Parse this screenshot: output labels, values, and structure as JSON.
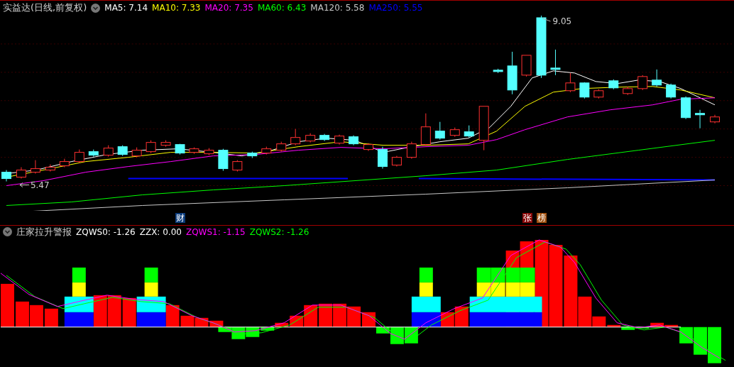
{
  "main_chart": {
    "title": "实益达(日线,前复权)",
    "indicators": [
      {
        "label": "MA5: 7.14",
        "color": "#ffffff"
      },
      {
        "label": "MA10: 7.33",
        "color": "#ffff00"
      },
      {
        "label": "MA20: 7.35",
        "color": "#ff00ff"
      },
      {
        "label": "MA60: 6.43",
        "color": "#00ff00"
      },
      {
        "label": "MA120: 5.58",
        "color": "#c8c8c8"
      },
      {
        "label": "MA250: 5.55",
        "color": "#0000ff"
      }
    ],
    "high_label": "9.05",
    "low_label": "5.47"
  },
  "event_badges": [
    {
      "label": "财",
      "color": "#0a3a7a"
    },
    {
      "label": "张",
      "color": "#8a0a0a"
    },
    {
      "label": "榜",
      "color": "#a05010"
    }
  ],
  "indicator_panel": {
    "title": "庄家拉升警报",
    "indicators": [
      {
        "label": "ZQWS0: -1.26",
        "color": "#ffffff"
      },
      {
        "label": "ZZX: 0.00",
        "color": "#ffffff"
      },
      {
        "label": "ZQWS1: -1.15",
        "color": "#ff00ff"
      },
      {
        "label": "ZQWS2: -1.26",
        "color": "#00ff00"
      }
    ]
  }
}
